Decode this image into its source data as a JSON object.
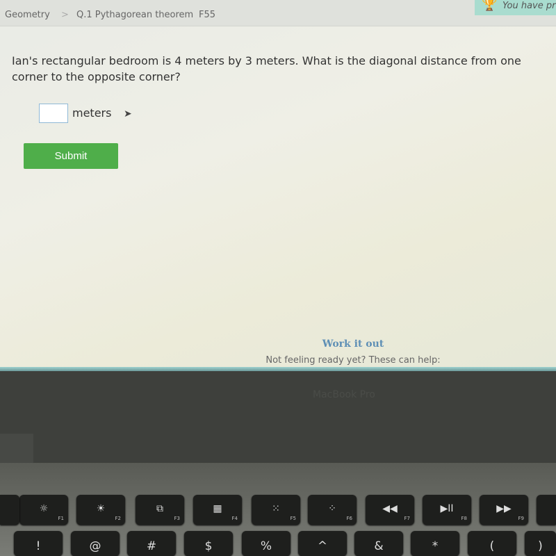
{
  "breadcrumb": {
    "subject": "Geometry",
    "separator": ">",
    "skill": "Q.1 Pythagorean theorem",
    "code": "F55"
  },
  "banner": {
    "text": "You have pri",
    "icon": "trophy-icon"
  },
  "question": {
    "text": "Ian's rectangular bedroom is 4 meters by 3 meters. What is the diagonal distance from one corner to the opposite corner?",
    "answer_value": "",
    "unit": "meters"
  },
  "submit_label": "Submit",
  "help": {
    "work_it_out": "Work it out",
    "not_ready": "Not feeling ready yet? These can help:"
  },
  "laptop_brand": "MacBook Pro",
  "colors": {
    "submit": "#4fae4a",
    "link": "#5e8fb5"
  },
  "keyboard": {
    "function_keys": [
      {
        "icon": "☼",
        "label": "F1"
      },
      {
        "icon": "☀",
        "label": "F2"
      },
      {
        "icon": "⧉",
        "label": "F3"
      },
      {
        "icon": "▦",
        "label": "F4"
      },
      {
        "icon": "⁙",
        "label": "F5"
      },
      {
        "icon": "⁘",
        "label": "F6"
      },
      {
        "icon": "◀◀",
        "label": "F7"
      },
      {
        "icon": "▶II",
        "label": "F8"
      },
      {
        "icon": "▶▶",
        "label": "F9"
      }
    ],
    "number_keys": [
      "!",
      "@",
      "#",
      "$",
      "%",
      "^",
      "&",
      "*",
      "(",
      ")"
    ]
  }
}
